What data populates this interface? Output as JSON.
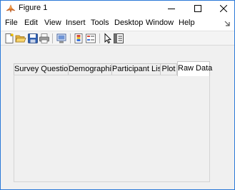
{
  "window": {
    "title": "Figure 1"
  },
  "menu": {
    "items": [
      "File",
      "Edit",
      "View",
      "Insert",
      "Tools",
      "Desktop",
      "Window",
      "Help"
    ]
  },
  "tabs": {
    "items": [
      "Survey Questions",
      "Demographic",
      "Participant List",
      "Plot",
      "Raw Data"
    ],
    "active_index": 4
  },
  "colors": {
    "frame_border": "#2b79d8",
    "figure_bg": "#f0f0f0"
  }
}
